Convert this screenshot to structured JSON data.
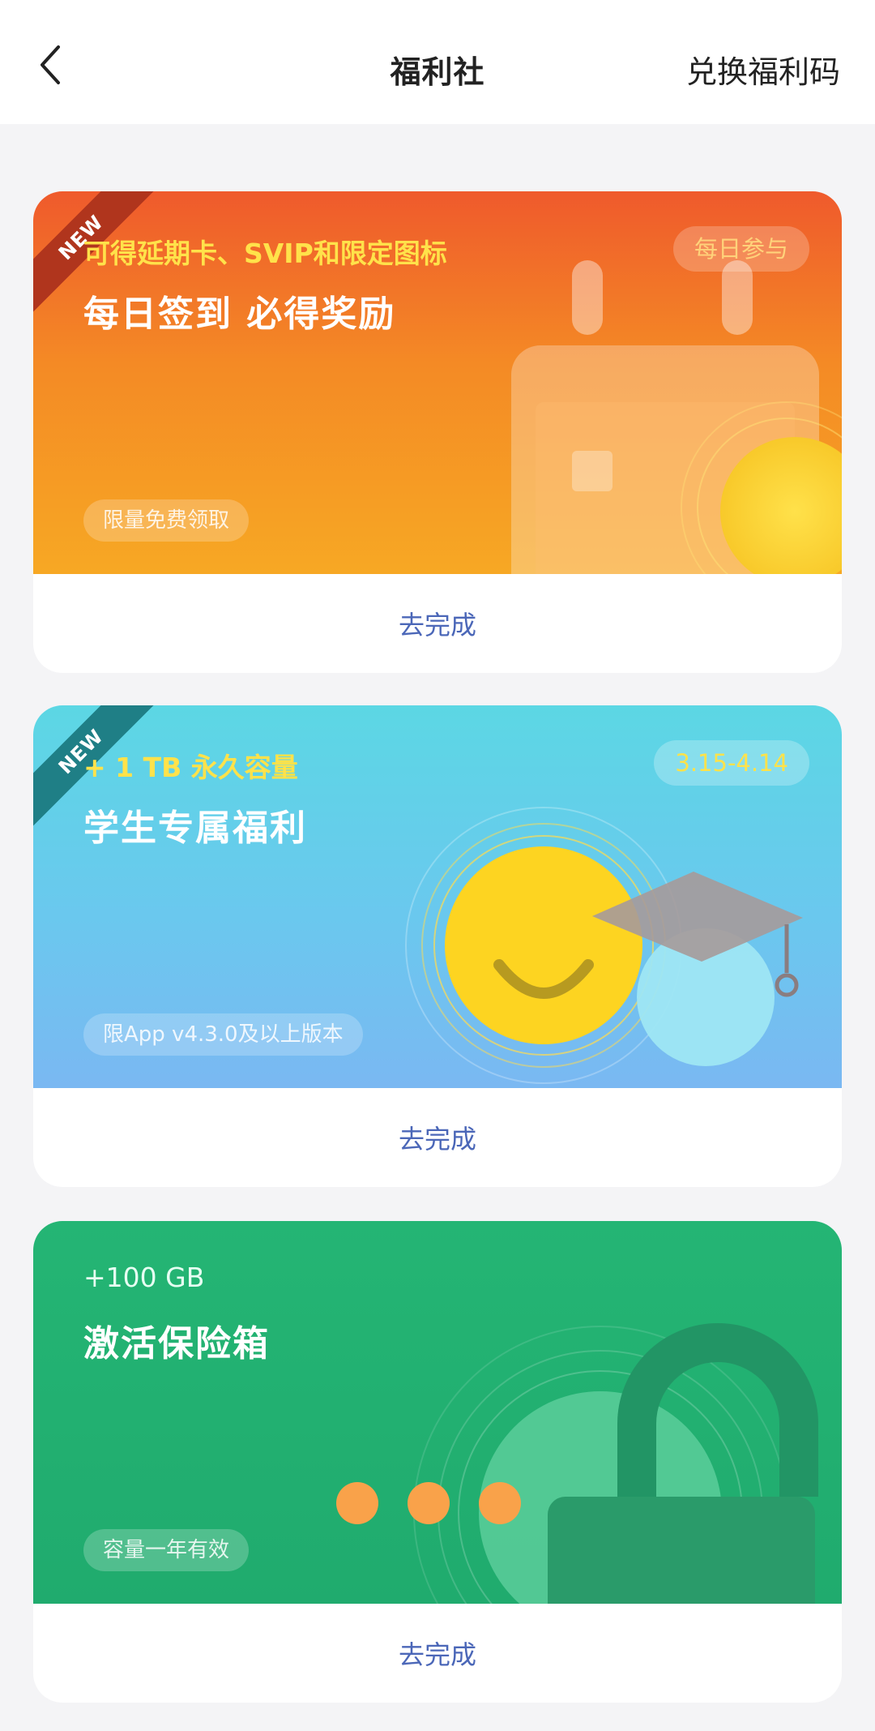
{
  "header": {
    "title": "福利社",
    "redeem_label": "兑换福利码"
  },
  "cards": [
    {
      "ribbon": "NEW",
      "subtitle": "可得延期卡、SVIP和限定图标",
      "title": "每日签到 必得奖励",
      "pill": "每日参与",
      "tag": "限量免费领取",
      "action": "去完成"
    },
    {
      "ribbon": "NEW",
      "subtitle": "+ 1 TB 永久容量",
      "title": "学生专属福利",
      "pill": "3.15-4.14",
      "tag": "限App v4.3.0及以上版本",
      "action": "去完成"
    },
    {
      "subtitle": "+100 GB",
      "title": "激活保险箱",
      "tag": "容量一年有效",
      "action": "去完成"
    }
  ],
  "icons": [
    "back-arrow-icon",
    "calendar-icon",
    "smiley-coin-icon",
    "graduation-cap-icon",
    "padlock-icon"
  ],
  "colors": {
    "action_text": "#4b67b8",
    "card1_banner": "#f48a25",
    "card2_banner": "#6ac8ee",
    "card3_banner": "#20ab6e"
  }
}
